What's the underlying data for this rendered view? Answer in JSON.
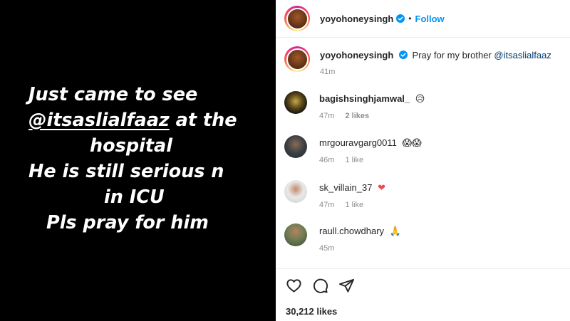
{
  "story": {
    "line1": "Just came to see",
    "line2_mention": "@itsaslialfaaz",
    "line2_rest": " at the",
    "line3": "hospital",
    "line4": "He is still serious n",
    "line5": "in ICU",
    "line6": "Pls pray for him"
  },
  "header": {
    "username": "yoyohoneysingh",
    "dot": "•",
    "follow_label": "Follow"
  },
  "caption": {
    "username": "yoyohoneysingh",
    "text": "Pray for my brother ",
    "mention": "@itsaslialfaaz",
    "time": "41m"
  },
  "comments": [
    {
      "username": "bagishsinghjamwal_",
      "emoji": "😥",
      "time": "47m",
      "likes": "2 likes",
      "avatar_color": "#1b1b1b"
    },
    {
      "username": "mrgouravgarg0011",
      "emoji": "😱😱",
      "time": "46m",
      "likes": "1 like",
      "avatar_color": "#2f3a3f"
    },
    {
      "username": "sk_villain_37",
      "emoji": "❤",
      "time": "47m",
      "likes": "1 like",
      "avatar_color": "#d9d9d9"
    },
    {
      "username": "raull.chowdhary",
      "emoji": "🙏",
      "time": "45m",
      "likes": "",
      "avatar_color": "#4b5d3d"
    }
  ],
  "footer": {
    "likes_count": "30,212 likes"
  },
  "colors": {
    "accent": "#0095f6",
    "link": "#00376b",
    "muted": "#8e8e8e",
    "heart": "#ed4956"
  },
  "icons": [
    "verified-icon",
    "heart-icon",
    "comment-icon",
    "share-icon"
  ]
}
